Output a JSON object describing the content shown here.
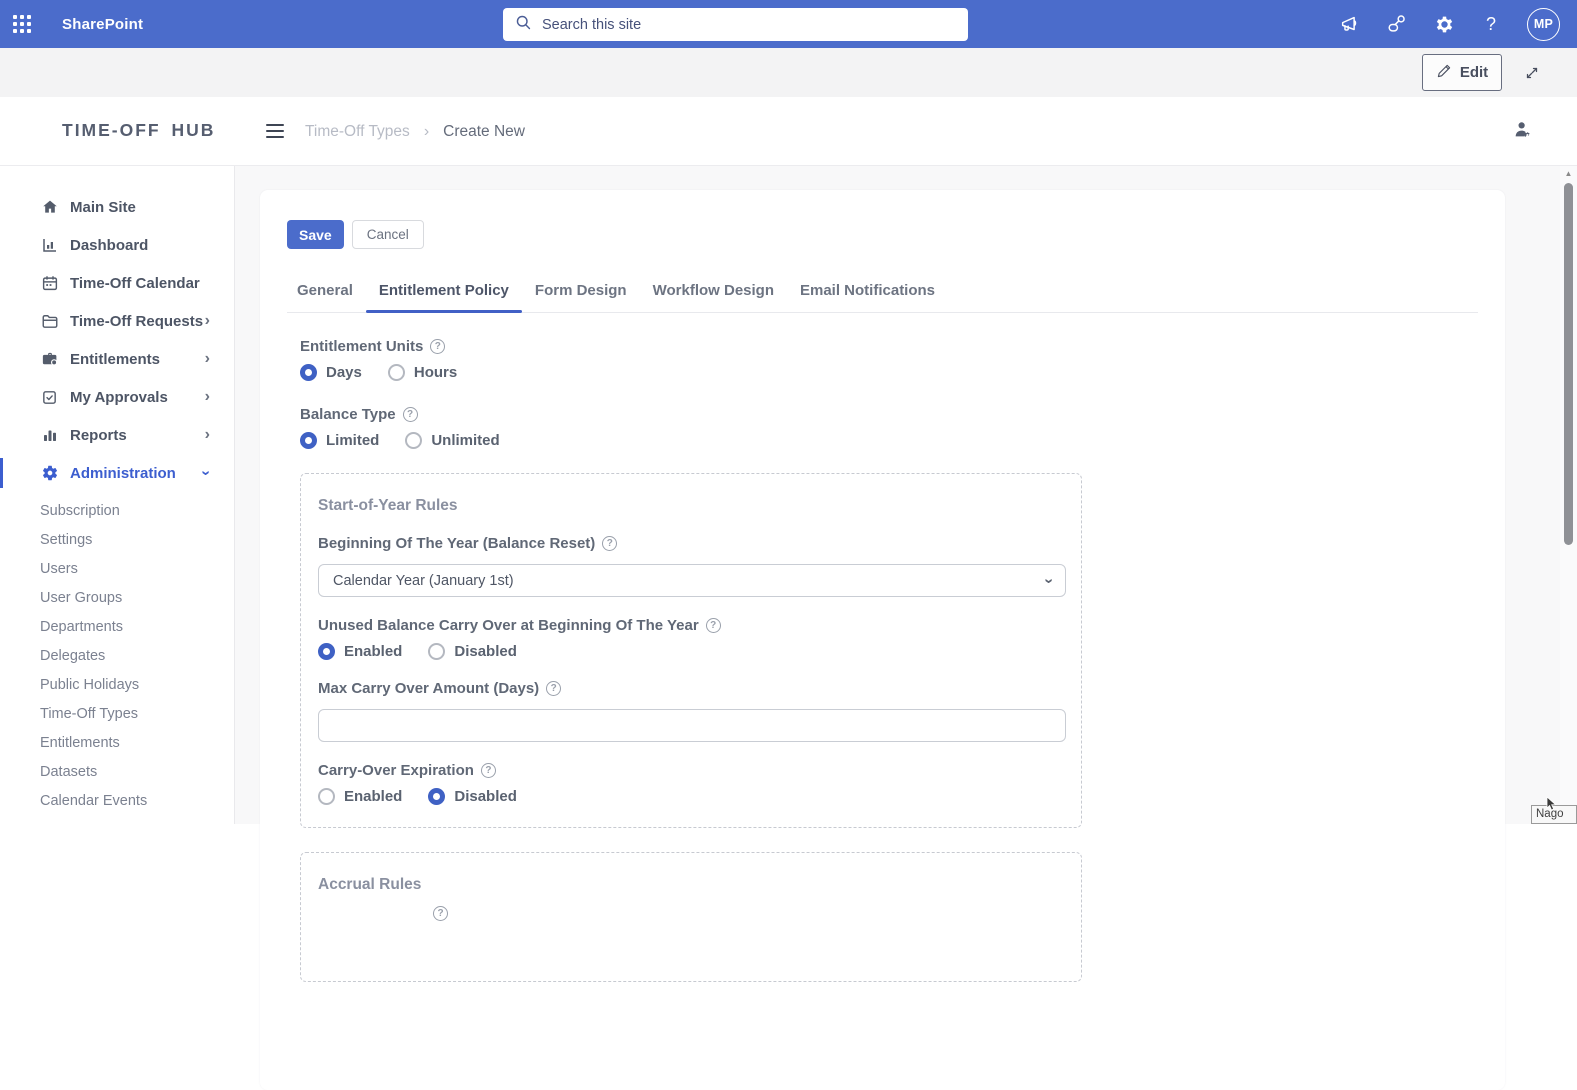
{
  "icons": {
    "help_q": "?",
    "chevron_right": "›",
    "breadcrumb_sep": "›",
    "scroll_up": "▲"
  },
  "colors": {
    "topbar_blue": "#4b6ccb",
    "accent_blue": "#4160c6",
    "content_bg": "#f8f8f9"
  },
  "topbar": {
    "app_name": "SharePoint",
    "search_placeholder": "Search this site",
    "avatar_initials": "MP"
  },
  "commandbar": {
    "edit_label": "Edit"
  },
  "header": {
    "logo_part1": "TIME-OFF",
    "logo_part2": "HUB",
    "breadcrumb": [
      "Time-Off Types",
      "Create New"
    ]
  },
  "sidebar": {
    "items": [
      {
        "label": "Main Site",
        "icon": "home",
        "submenu": false
      },
      {
        "label": "Dashboard",
        "icon": "dashboard",
        "submenu": false
      },
      {
        "label": "Time-Off Calendar",
        "icon": "calendar",
        "submenu": false
      },
      {
        "label": "Time-Off Requests",
        "icon": "folder",
        "submenu": true
      },
      {
        "label": "Entitlements",
        "icon": "briefcase",
        "submenu": true
      },
      {
        "label": "My Approvals",
        "icon": "check-square",
        "submenu": true
      },
      {
        "label": "Reports",
        "icon": "bar-chart",
        "submenu": true
      },
      {
        "label": "Administration",
        "icon": "gear",
        "submenu": true,
        "active": true,
        "expanded": true
      }
    ],
    "admin_subitems": [
      "Subscription",
      "Settings",
      "Users",
      "User Groups",
      "Departments",
      "Delegates",
      "Public Holidays",
      "Time-Off Types",
      "Entitlements",
      "Datasets",
      "Calendar Events"
    ]
  },
  "content": {
    "save_label": "Save",
    "cancel_label": "Cancel",
    "tabs": [
      {
        "label": "General",
        "active": false
      },
      {
        "label": "Entitlement Policy",
        "active": true
      },
      {
        "label": "Form Design",
        "active": false
      },
      {
        "label": "Workflow Design",
        "active": false
      },
      {
        "label": "Email Notifications",
        "active": false
      }
    ],
    "fields": {
      "entitlement_units": {
        "label": "Entitlement Units",
        "options": [
          "Days",
          "Hours"
        ],
        "value": "Days"
      },
      "balance_type": {
        "label": "Balance Type",
        "options": [
          "Limited",
          "Unlimited"
        ],
        "value": "Limited"
      },
      "start_of_year": {
        "title": "Start-of-Year Rules",
        "beginning_of_year": {
          "label": "Beginning Of The Year (Balance Reset)",
          "value": "Calendar Year (January 1st)"
        },
        "carry_over": {
          "label": "Unused Balance Carry Over at Beginning Of The Year",
          "options": [
            "Enabled",
            "Disabled"
          ],
          "value": "Enabled"
        },
        "max_carry_over": {
          "label": "Max Carry Over Amount (Days)",
          "value": ""
        },
        "carry_over_expiration": {
          "label": "Carry-Over Expiration",
          "options": [
            "Enabled",
            "Disabled"
          ],
          "value": "Disabled"
        }
      },
      "accrual": {
        "title": "Accrual Rules"
      }
    }
  },
  "tooltip": {
    "text": "Nago"
  }
}
